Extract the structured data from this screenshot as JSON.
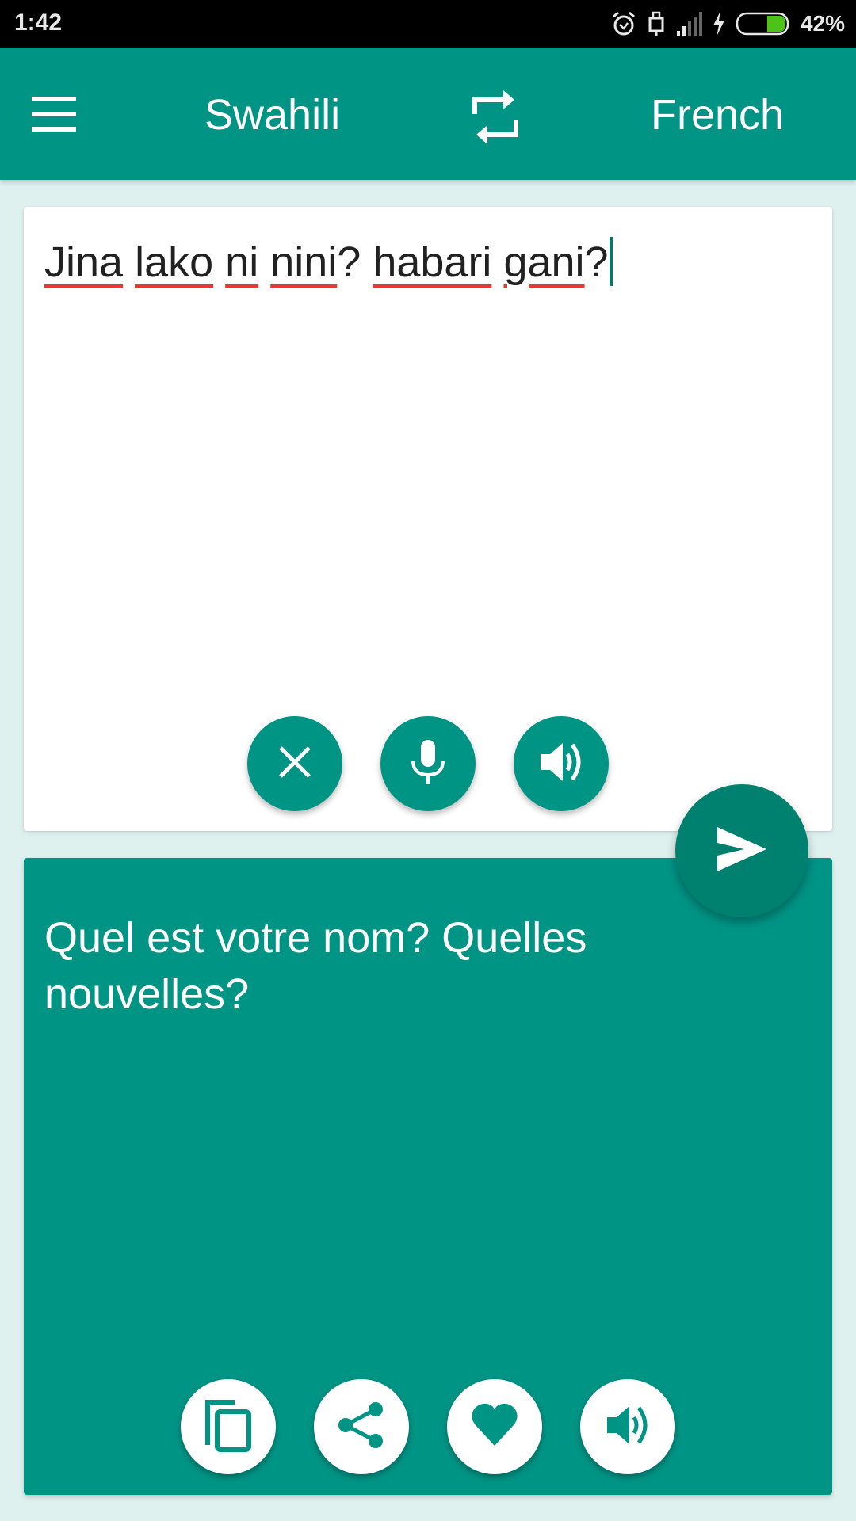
{
  "status_bar": {
    "time": "1:42",
    "battery_percent": "42%",
    "battery_level": 0.42,
    "icons": [
      "alarm-icon",
      "usb-icon",
      "signal-icon",
      "charging-icon",
      "battery-icon"
    ]
  },
  "app_bar": {
    "menu_icon": "menu-icon",
    "source_language": "Swahili",
    "swap_icon": "swap-icon",
    "target_language": "French"
  },
  "input": {
    "words": [
      "Jina",
      "lako",
      "ni",
      "nini",
      "habari",
      "gani"
    ],
    "text": "Jina lako ni nini? habari gani?",
    "buttons": [
      {
        "name": "clear",
        "icon": "close-icon"
      },
      {
        "name": "voice-input",
        "icon": "microphone-icon"
      },
      {
        "name": "speak-source",
        "icon": "speaker-icon"
      }
    ]
  },
  "translate_button": {
    "icon": "send-icon"
  },
  "output": {
    "text": "Quel est votre nom? Quelles nouvelles?",
    "buttons": [
      {
        "name": "copy",
        "icon": "copy-icon"
      },
      {
        "name": "share",
        "icon": "share-icon"
      },
      {
        "name": "favorite",
        "icon": "heart-icon"
      },
      {
        "name": "speak-target",
        "icon": "speaker-icon"
      }
    ]
  },
  "colors": {
    "primary": "#009485",
    "primary_dark": "#00806f",
    "background": "#dff1ef",
    "spellcheck_underline": "#e53935",
    "battery_fill": "#4cc417"
  }
}
